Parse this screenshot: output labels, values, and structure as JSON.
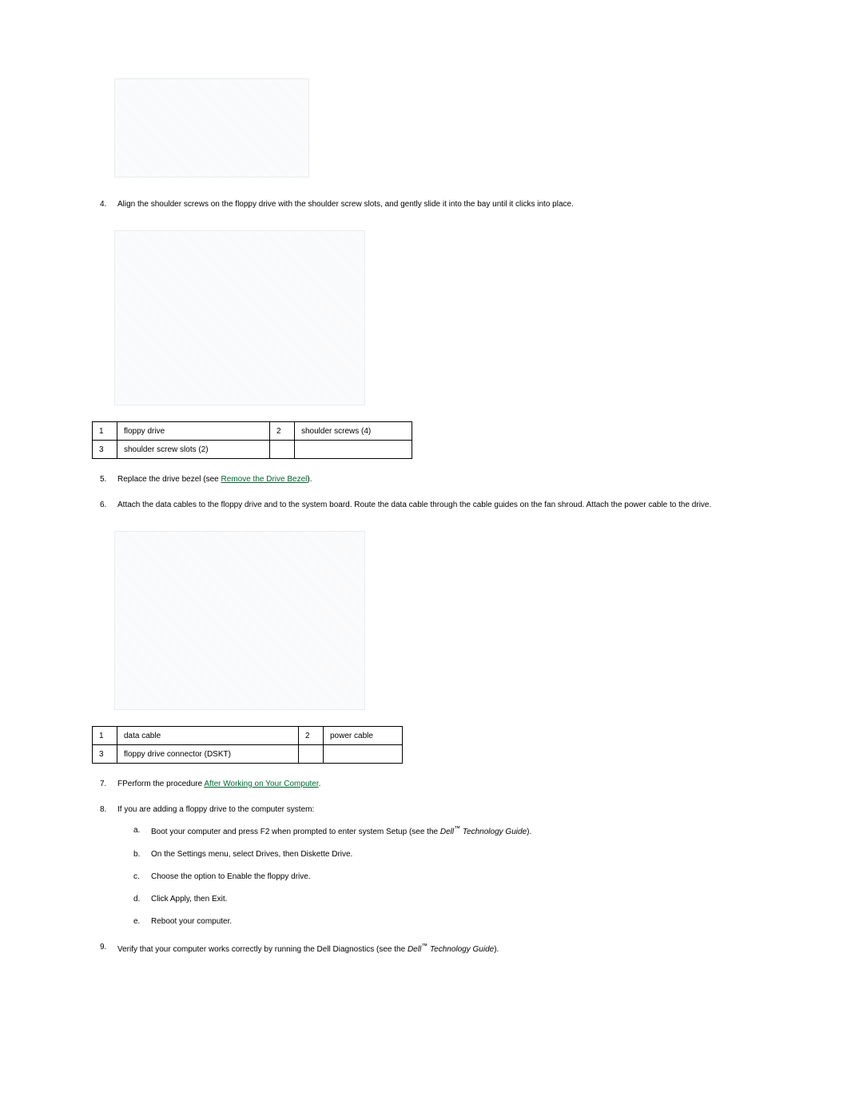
{
  "steps": {
    "s4": {
      "num": "4.",
      "text": "Align the shoulder screws on the floppy drive with the shoulder screw slots, and gently slide it into the bay until it clicks into place."
    },
    "s5": {
      "num": "5.",
      "text_before": "Replace the drive bezel (see ",
      "link": "Remove the Drive Bezel",
      "text_after": ")."
    },
    "s6": {
      "num": "6.",
      "text": "Attach the data cables to the floppy drive and to the system board. Route the data cable through the cable guides on the fan shroud. Attach the power cable to the drive."
    },
    "s7": {
      "num": "7.",
      "text_before": "FPerform the procedure ",
      "link": "After Working on Your Computer",
      "text_after": "."
    },
    "s8": {
      "num": "8.",
      "text": "If you are adding a floppy drive to the computer system:",
      "sub": {
        "a": {
          "num": "a.",
          "before": "Boot your computer and press F2 when prompted to enter system Setup (see the ",
          "italic1": "Dell",
          "tm": "™",
          "italic2": " Technology Guide",
          "after": ")."
        },
        "b": {
          "num": "b.",
          "text": "On the Settings menu, select Drives, then Diskette Drive."
        },
        "c": {
          "num": "c.",
          "text": "Choose the option to Enable the floppy drive."
        },
        "d": {
          "num": "d.",
          "text": "Click Apply, then Exit."
        },
        "e": {
          "num": "e.",
          "text": "Reboot your computer."
        }
      }
    },
    "s9": {
      "num": "9.",
      "before": "Verify that your computer works correctly by running the Dell Diagnostics (see the ",
      "italic1": "Dell",
      "tm": "™",
      "italic2": " Technology Guide",
      "after": ")."
    }
  },
  "table1": {
    "r1c1": "1",
    "r1c2": "floppy drive",
    "r1c3": "2",
    "r1c4": "shoulder screws (4)",
    "r2c1": "3",
    "r2c2": "shoulder screw slots (2)",
    "r2c3": "",
    "r2c4": ""
  },
  "table2": {
    "r1c1": "1",
    "r1c2": "data cable",
    "r1c3": "2",
    "r1c4": "power cable",
    "r2c1": "3",
    "r2c2": "floppy drive connector (DSKT)",
    "r2c3": "",
    "r2c4": ""
  }
}
